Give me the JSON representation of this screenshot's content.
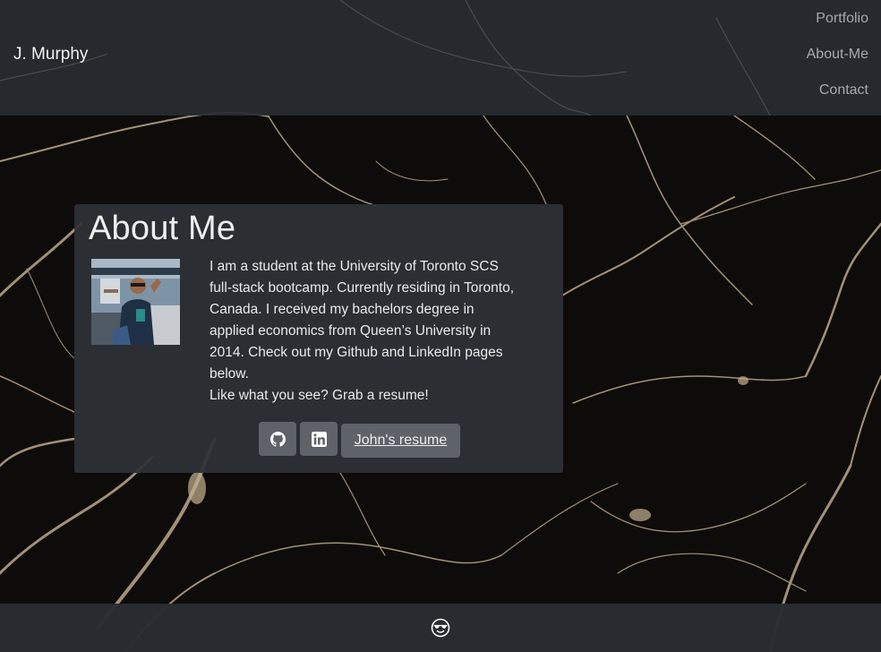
{
  "navbar": {
    "brand": "J. Murphy",
    "links": [
      {
        "label": "Portfolio"
      },
      {
        "label": "About-Me"
      },
      {
        "label": "Contact"
      }
    ]
  },
  "about": {
    "title": "About Me",
    "bio": "I am a student at the University of Toronto SCS full-stack bootcamp. Currently residing in Toronto, Canada. I received my bachelors degree in applied economics from Queen’s University in 2014. Check out my Github and LinkedIn pages below.",
    "cta": "Like what you see? Grab a resume!",
    "buttons": {
      "github_icon": "github-icon",
      "linkedin_icon": "linkedin-icon",
      "resume_label": "John's resume"
    }
  },
  "footer": {
    "icon": "sunglasses-emoji-icon"
  },
  "colors": {
    "navbar_bg": "#292c31",
    "card_bg": "#2e3136",
    "button_bg": "#5e6269",
    "nav_link": "#a7a9ab",
    "background": "#0c0b0a"
  }
}
